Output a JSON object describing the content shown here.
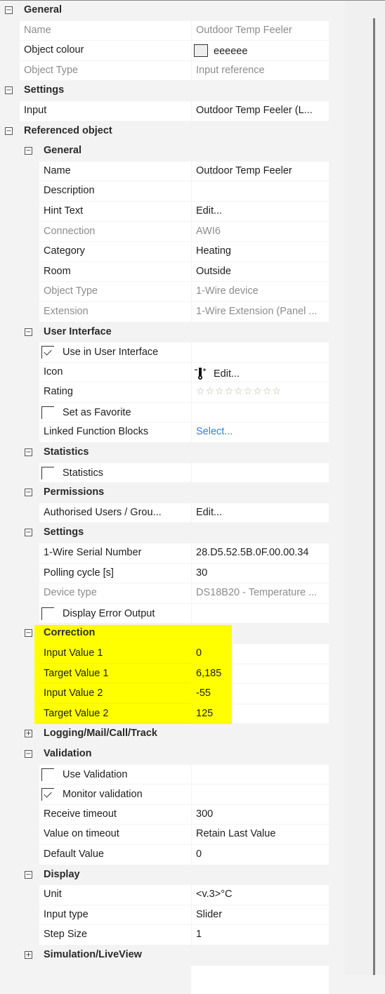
{
  "panel": {
    "sections": [
      {
        "id": "general",
        "title": "General",
        "level": 0,
        "expanded": true,
        "rows": [
          {
            "label": "Name",
            "value": "Outdoor Temp Feeler",
            "disabled": true
          },
          {
            "label": "Object colour",
            "value": "eeeeee",
            "swatch_color": "#eeeeee"
          },
          {
            "label": "Object Type",
            "value": "Input reference",
            "disabled": true
          }
        ]
      },
      {
        "id": "settings",
        "title": "Settings",
        "level": 0,
        "expanded": true,
        "rows": [
          {
            "label": "Input",
            "value": "Outdoor Temp Feeler (L..."
          }
        ]
      },
      {
        "id": "referenced",
        "title": "Referenced object",
        "level": 0,
        "expanded": true,
        "rows": []
      },
      {
        "id": "ref-general",
        "title": "General",
        "level": 1,
        "expanded": true,
        "rows": [
          {
            "label": "Name",
            "value": "Outdoor Temp Feeler"
          },
          {
            "label": "Description",
            "value": ""
          },
          {
            "label": "Hint Text",
            "value": "Edit..."
          },
          {
            "label": "Connection",
            "value": "AWI6",
            "disabled": true
          },
          {
            "label": "Category",
            "value": "Heating"
          },
          {
            "label": "Room",
            "value": "Outside"
          },
          {
            "label": "Object Type",
            "value": "1-Wire device",
            "disabled": true
          },
          {
            "label": "Extension",
            "value": "1-Wire Extension (Panel ...",
            "disabled": true
          }
        ]
      },
      {
        "id": "user-interface",
        "title": "User Interface",
        "level": 1,
        "expanded": true,
        "rows": [
          {
            "label": "Use in User Interface",
            "checkbox": true,
            "checked": true
          },
          {
            "label": "Icon",
            "value": "Edit...",
            "icon": "thermometer-icon"
          },
          {
            "label": "Rating",
            "value": "☆☆☆☆☆☆☆☆☆",
            "rating": 0
          },
          {
            "label": "Set as Favorite",
            "checkbox": true,
            "checked": false
          },
          {
            "label": "Linked Function Blocks",
            "value": "Select...",
            "link": true
          }
        ]
      },
      {
        "id": "statistics",
        "title": "Statistics",
        "level": 1,
        "expanded": true,
        "rows": [
          {
            "label": "Statistics",
            "checkbox": true,
            "checked": false
          }
        ]
      },
      {
        "id": "permissions",
        "title": "Permissions",
        "level": 1,
        "expanded": true,
        "rows": [
          {
            "label": "Authorised Users / Grou...",
            "value": "Edit..."
          }
        ]
      },
      {
        "id": "ref-settings",
        "title": "Settings",
        "level": 1,
        "expanded": true,
        "rows": [
          {
            "label": "1-Wire Serial Number",
            "value": "28.D5.52.5B.0F.00.00.34"
          },
          {
            "label": "Polling cycle [s]",
            "value": "30"
          },
          {
            "label": "Device type",
            "value": "DS18B20 - Temperature ...",
            "disabled": true
          },
          {
            "label": "Display Error Output",
            "checkbox": true,
            "checked": false
          }
        ]
      },
      {
        "id": "correction",
        "title": "Correction",
        "level": 1,
        "expanded": true,
        "highlighted": true,
        "rows": [
          {
            "label": "Input Value 1",
            "value": "0"
          },
          {
            "label": "Target Value 1",
            "value": "6,185"
          },
          {
            "label": "Input Value 2",
            "value": "-55"
          },
          {
            "label": "Target Value 2",
            "value": "125"
          }
        ]
      },
      {
        "id": "logging",
        "title": "Logging/Mail/Call/Track",
        "level": 1,
        "expanded": false,
        "rows": []
      },
      {
        "id": "validation",
        "title": "Validation",
        "level": 1,
        "expanded": true,
        "rows": [
          {
            "label": "Use Validation",
            "checkbox": true,
            "checked": false
          },
          {
            "label": "Monitor validation",
            "checkbox": true,
            "checked": true
          },
          {
            "label": "Receive timeout",
            "value": "300"
          },
          {
            "label": "Value on timeout",
            "value": "Retain Last Value"
          },
          {
            "label": "Default Value",
            "value": "0"
          }
        ]
      },
      {
        "id": "display",
        "title": "Display",
        "level": 1,
        "expanded": true,
        "rows": [
          {
            "label": "Unit",
            "value": "<v.3>°C"
          },
          {
            "label": "Input type",
            "value": "Slider"
          },
          {
            "label": "Step Size",
            "value": "1"
          }
        ]
      },
      {
        "id": "simulation",
        "title": "Simulation/LiveView",
        "level": 1,
        "expanded": false,
        "rows": []
      }
    ],
    "toggle_glyphs": {
      "expanded": "−",
      "collapsed": "+"
    },
    "highlight_color": "#ffff00"
  }
}
